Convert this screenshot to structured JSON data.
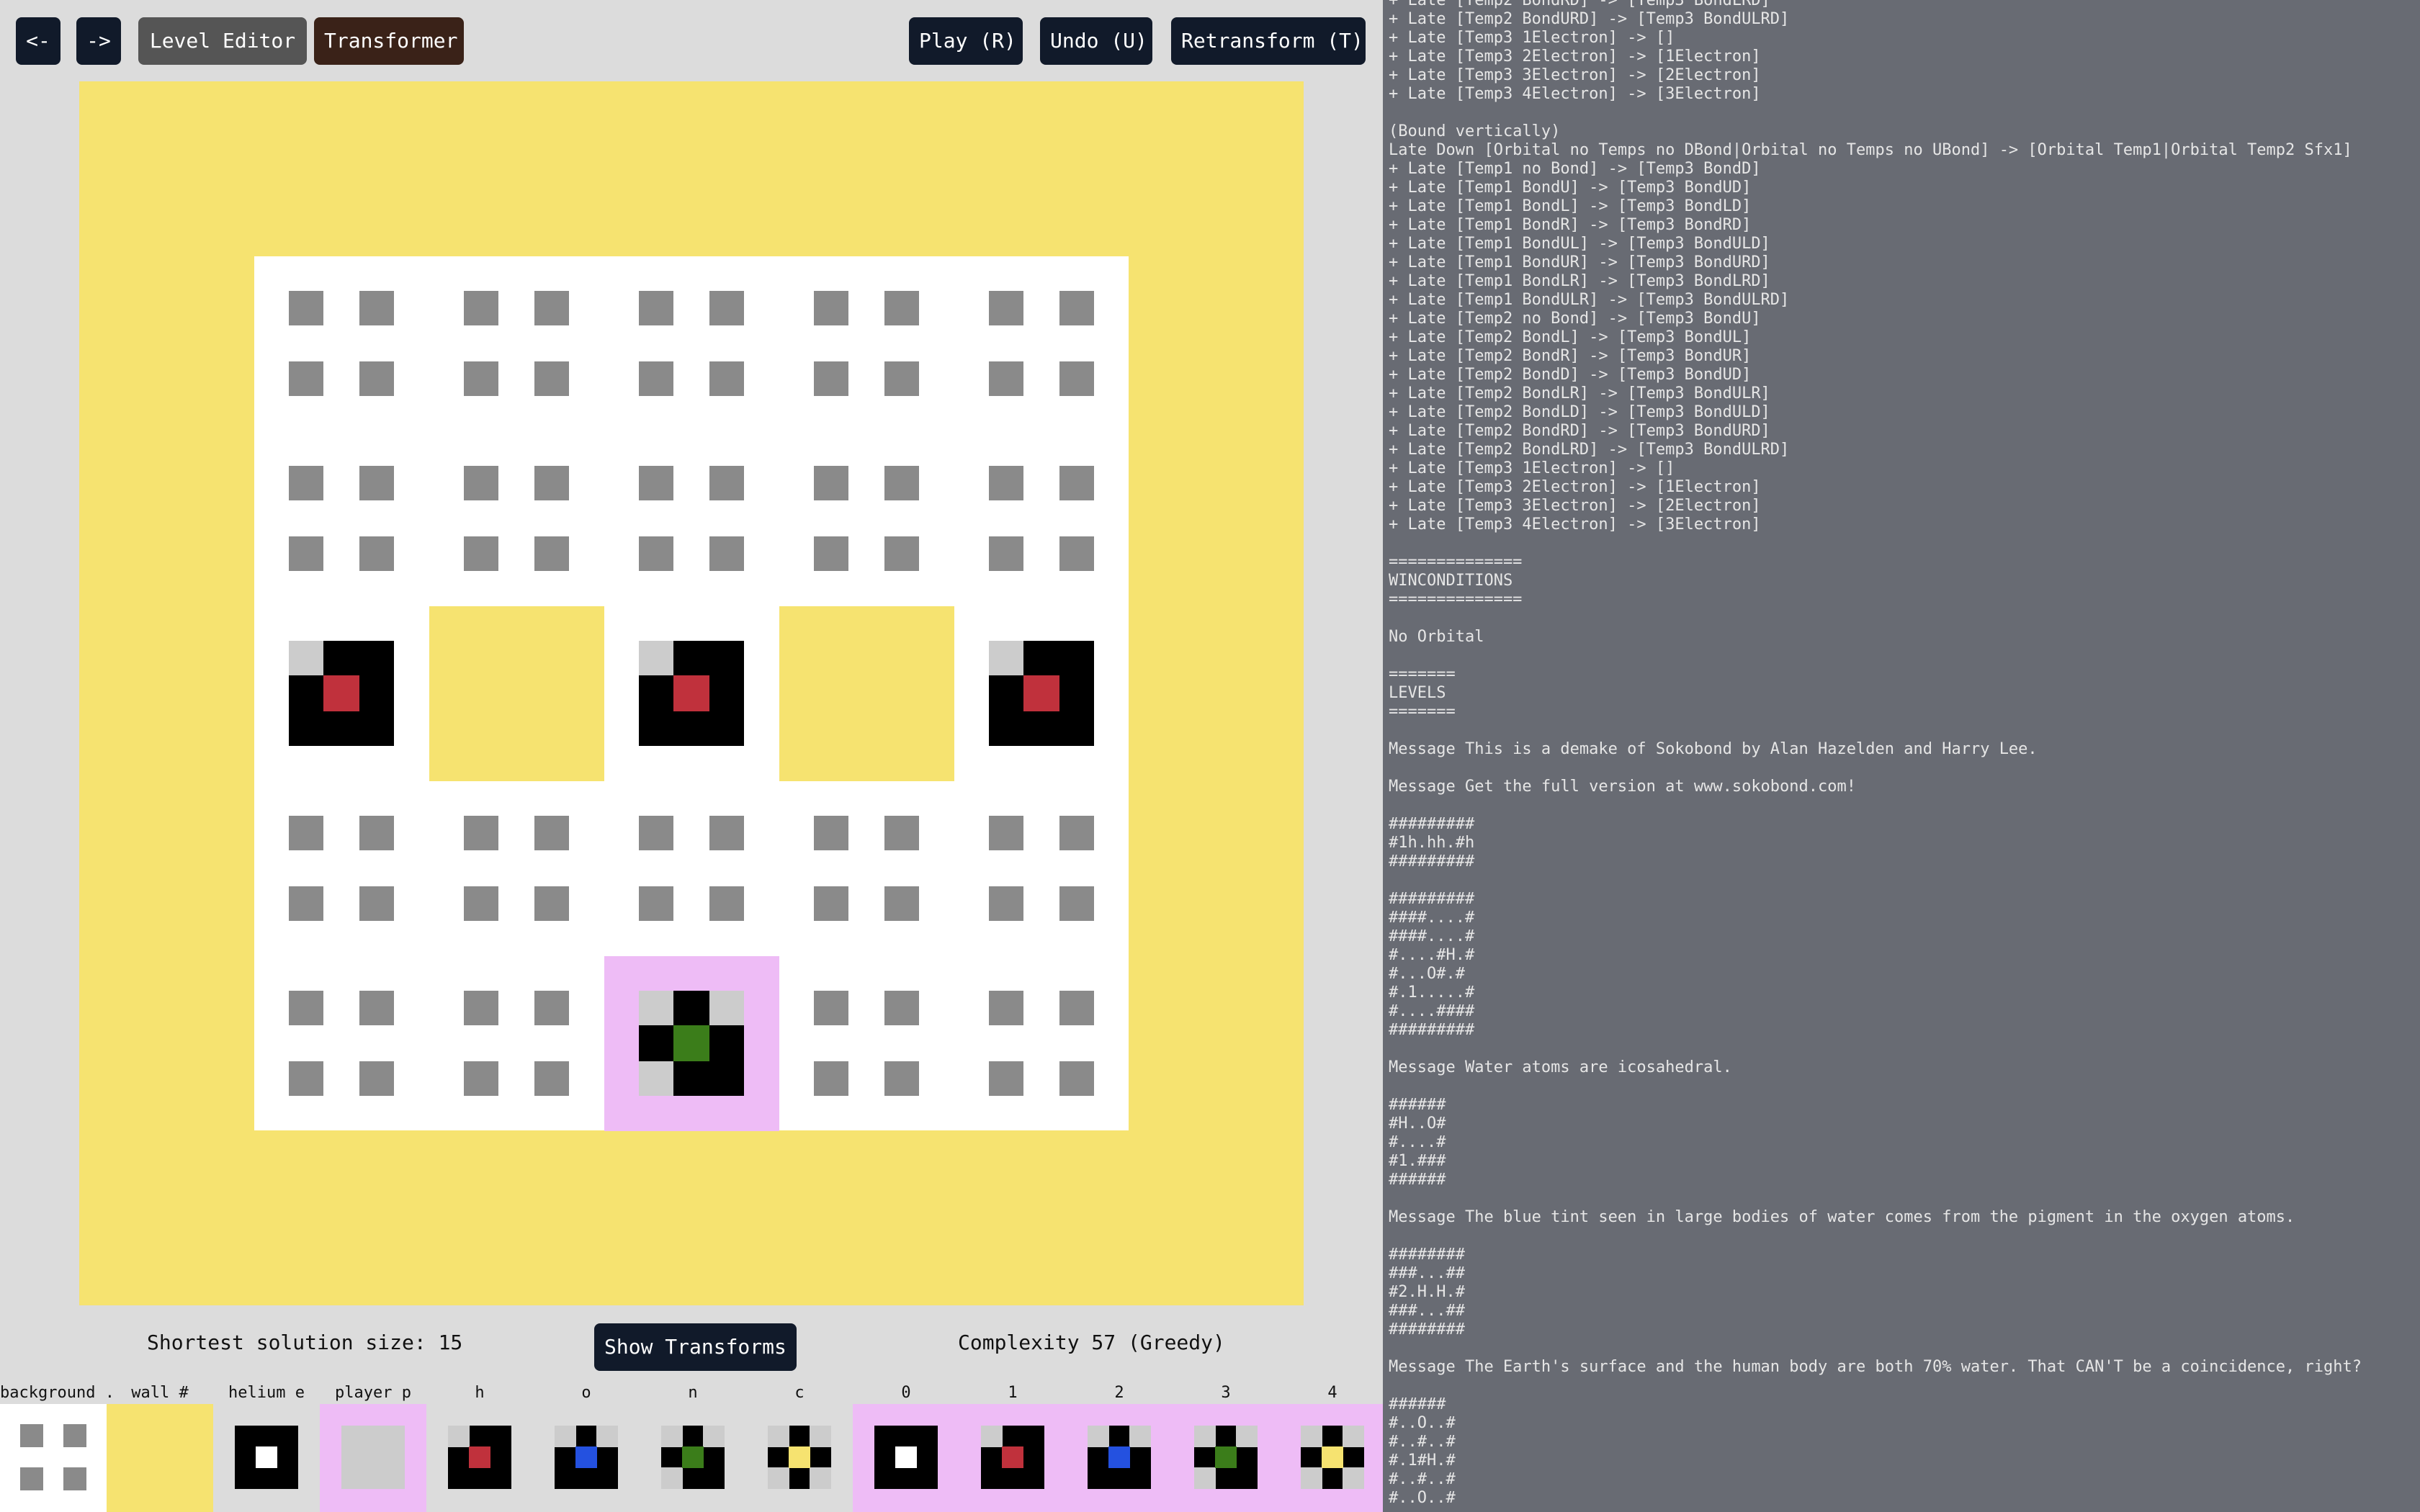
{
  "toolbar": {
    "back": "<-",
    "forward": "->",
    "level_editor": "Level Editor",
    "transformer": "Transformer",
    "play": "Play (R)",
    "undo": "Undo (U)",
    "retransform": "Retransform (T)"
  },
  "status": {
    "shortest_solution": "Shortest solution size: 15",
    "show_transforms": "Show Transforms",
    "complexity": "Complexity 57 (Greedy)"
  },
  "palette": [
    {
      "label": "background .",
      "icon": "background-icon"
    },
    {
      "label": "wall #",
      "icon": "wall-icon"
    },
    {
      "label": "helium e",
      "icon": "helium-icon"
    },
    {
      "label": "player p",
      "icon": "player-icon"
    },
    {
      "label": "h",
      "icon": "hydrogen-icon"
    },
    {
      "label": "o",
      "icon": "oxygen-icon"
    },
    {
      "label": "n",
      "icon": "nitrogen-icon"
    },
    {
      "label": "c",
      "icon": "carbon-icon"
    },
    {
      "label": "0",
      "icon": "atom-0-icon"
    },
    {
      "label": "1",
      "icon": "atom-1-icon"
    },
    {
      "label": "2",
      "icon": "atom-2-icon"
    },
    {
      "label": "3",
      "icon": "atom-3-icon"
    },
    {
      "label": "4",
      "icon": "atom-4-icon"
    }
  ],
  "colors": {
    "wall": "#f6e370",
    "floor": "#ffffff",
    "player_bg": "#eebcf6",
    "hydrogen": "#c0313c",
    "oxygen": "#2451e0",
    "nitrogen": "#3b7d1a",
    "carbon": "#f6e370",
    "code_panel": "#686b73"
  },
  "code_text": "+ Late [Temp2 BondRD] -> [Temp3 BondLRD]\n+ Late [Temp2 BondURD] -> [Temp3 BondULRD]\n+ Late [Temp3 1Electron] -> []\n+ Late [Temp3 2Electron] -> [1Electron]\n+ Late [Temp3 3Electron] -> [2Electron]\n+ Late [Temp3 4Electron] -> [3Electron]\n\n(Bound vertically)\nLate Down [Orbital no Temps no DBond|Orbital no Temps no UBond] -> [Orbital Temp1|Orbital Temp2 Sfx1]\n+ Late [Temp1 no Bond] -> [Temp3 BondD]\n+ Late [Temp1 BondU] -> [Temp3 BondUD]\n+ Late [Temp1 BondL] -> [Temp3 BondLD]\n+ Late [Temp1 BondR] -> [Temp3 BondRD]\n+ Late [Temp1 BondUL] -> [Temp3 BondULD]\n+ Late [Temp1 BondUR] -> [Temp3 BondURD]\n+ Late [Temp1 BondLR] -> [Temp3 BondLRD]\n+ Late [Temp1 BondULR] -> [Temp3 BondULRD]\n+ Late [Temp2 no Bond] -> [Temp3 BondU]\n+ Late [Temp2 BondL] -> [Temp3 BondUL]\n+ Late [Temp2 BondR] -> [Temp3 BondUR]\n+ Late [Temp2 BondD] -> [Temp3 BondUD]\n+ Late [Temp2 BondLR] -> [Temp3 BondULR]\n+ Late [Temp2 BondLD] -> [Temp3 BondULD]\n+ Late [Temp2 BondRD] -> [Temp3 BondURD]\n+ Late [Temp2 BondLRD] -> [Temp3 BondULRD]\n+ Late [Temp3 1Electron] -> []\n+ Late [Temp3 2Electron] -> [1Electron]\n+ Late [Temp3 3Electron] -> [2Electron]\n+ Late [Temp3 4Electron] -> [3Electron]\n\n==============\nWINCONDITIONS\n==============\n\nNo Orbital\n\n=======\nLEVELS\n=======\n\nMessage This is a demake of Sokobond by Alan Hazelden and Harry Lee.\n\nMessage Get the full version at www.sokobond.com!\n\n#########\n#1h.hh.#h\n#########\n\n#########\n####....#\n####....#\n#....#H.#\n#...O#.#\n#.1.....#\n#....####\n#########\n\nMessage Water atoms are icosahedral.\n\n######\n#H..O#\n#....#\n#1.###\n######\n\nMessage The blue tint seen in large bodies of water comes from the pigment in the oxygen atoms.\n\n########\n###...##\n#2.H.H.#\n###...##\n########\n\nMessage The Earth's surface and the human body are both 70% water. That CAN'T be a coincidence, right?\n\n######\n#..O..#\n#..#..#\n#.1#H.#\n#..#..#\n#..O..#"
}
